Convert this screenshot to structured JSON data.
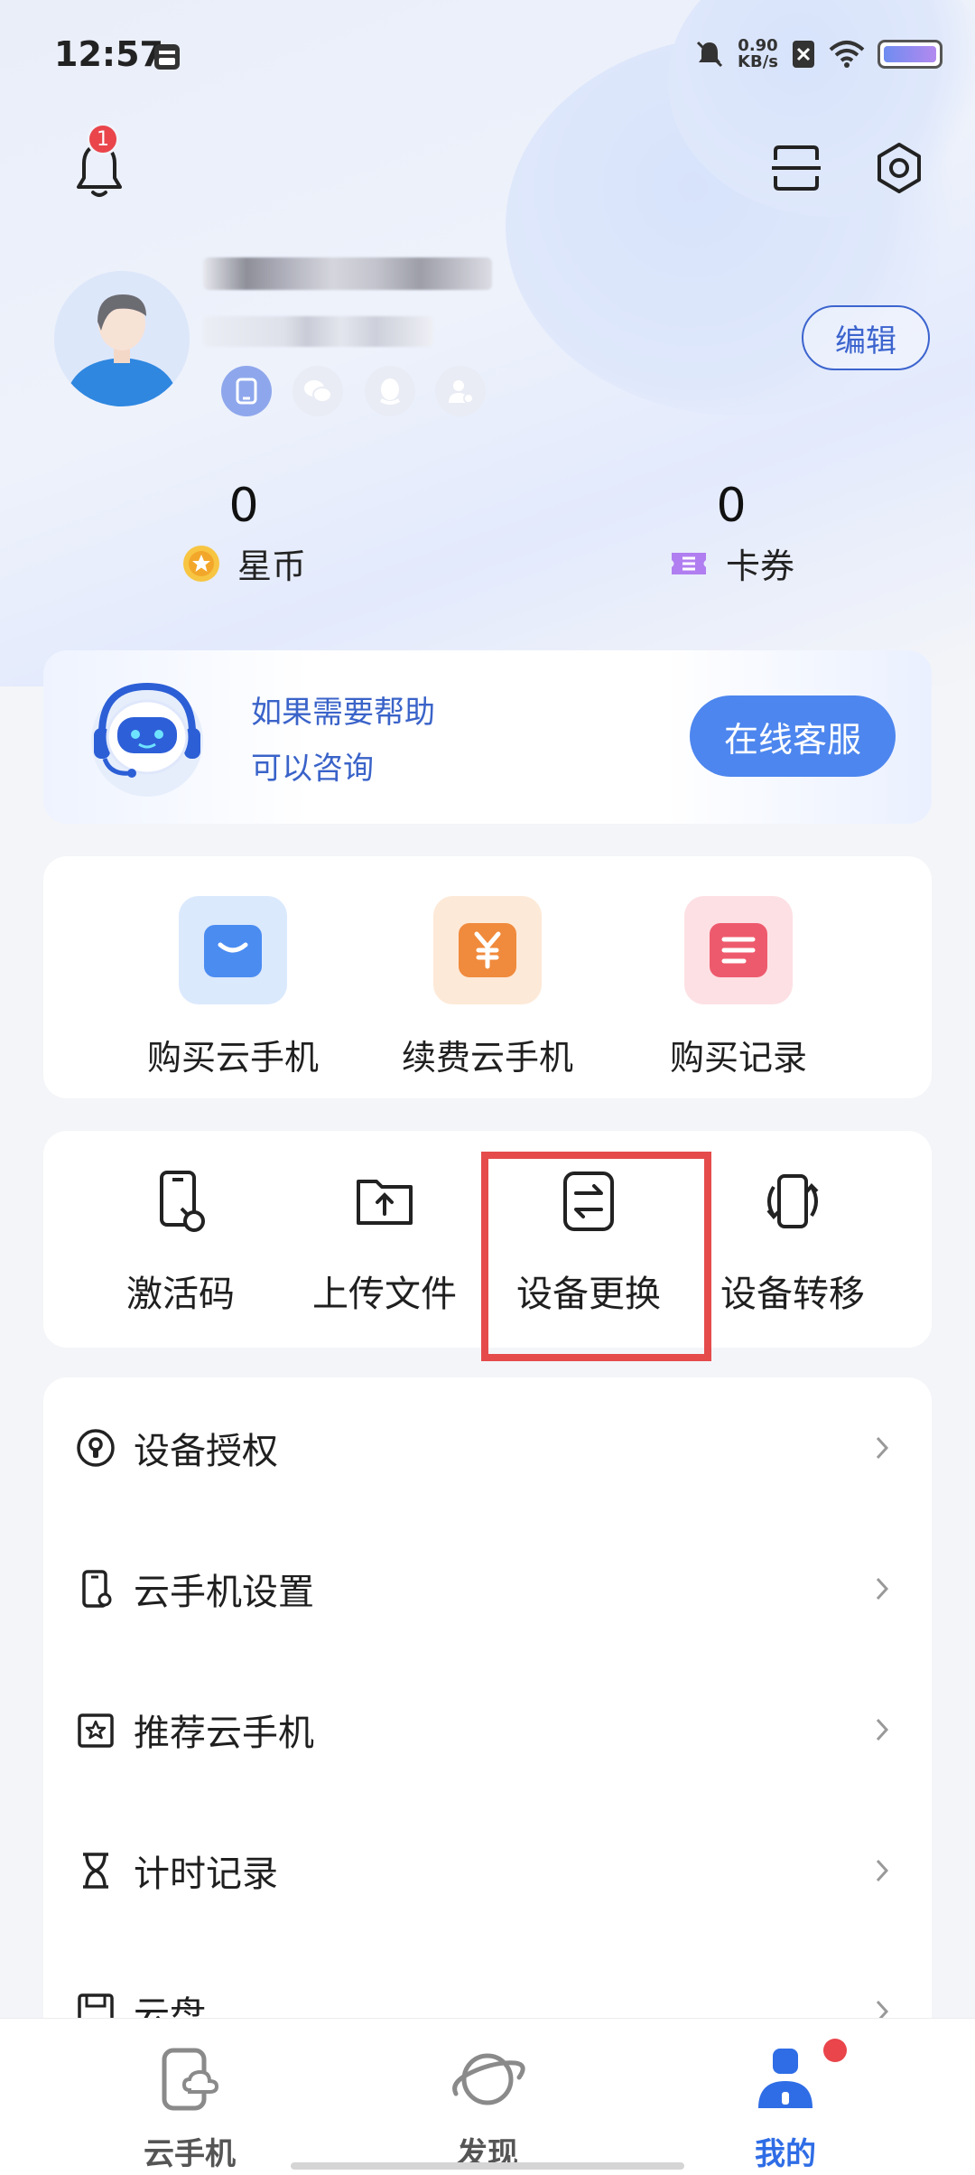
{
  "status_bar": {
    "time": "12:57",
    "net_speed_value": "0.90",
    "net_speed_unit": "KB/s"
  },
  "header": {
    "notification_count": "1"
  },
  "profile": {
    "edit_label": "编辑"
  },
  "stats": [
    {
      "value": "0",
      "label": "星币",
      "icon": "star-coin-icon"
    },
    {
      "value": "0",
      "label": "卡券",
      "icon": "ticket-icon"
    }
  ],
  "help": {
    "line1": "如果需要帮助",
    "line2": "可以咨询",
    "button_label": "在线客服"
  },
  "purchase": [
    {
      "label": "购买云手机",
      "icon": "shopping-bag-icon",
      "color": "#4b8cf1"
    },
    {
      "label": "续费云手机",
      "icon": "yuan-icon",
      "color": "#f08a3c"
    },
    {
      "label": "购买记录",
      "icon": "list-icon",
      "color": "#ee5a6d"
    }
  ],
  "tools": [
    {
      "label": "激活码",
      "icon": "activation-phone-icon"
    },
    {
      "label": "上传文件",
      "icon": "upload-folder-icon"
    },
    {
      "label": "设备更换",
      "icon": "swap-icon"
    },
    {
      "label": "设备转移",
      "icon": "transfer-icon"
    }
  ],
  "menu": [
    {
      "label": "设备授权",
      "icon": "lock-circle-icon"
    },
    {
      "label": "云手机设置",
      "icon": "phone-settings-icon"
    },
    {
      "label": "推荐云手机",
      "icon": "star-box-icon"
    },
    {
      "label": "计时记录",
      "icon": "hourglass-icon"
    },
    {
      "label": "云盘",
      "icon": "cloud-disk-icon"
    }
  ],
  "bottom_nav": [
    {
      "label": "云手机",
      "icon": "cloud-phone-icon"
    },
    {
      "label": "发现",
      "icon": "planet-icon"
    },
    {
      "label": "我的",
      "icon": "profile-icon",
      "active": true
    }
  ],
  "colors": {
    "accent": "#2f6de6",
    "highlight_border": "#e54b4b",
    "help_text": "#3a63c9"
  }
}
